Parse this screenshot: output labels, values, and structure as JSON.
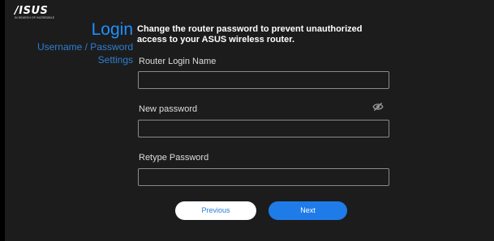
{
  "brand": {
    "logo_text": "/ISUS",
    "tagline": "IN SEARCH OF INCREDIBLE"
  },
  "sidebar": {
    "title": "Login",
    "subtitle_line1": "Username / Password",
    "subtitle_line2": "Settings"
  },
  "main": {
    "heading": "Change the router password to prevent unauthorized access to your ASUS wireless router.",
    "fields": [
      {
        "label": "Router Login Name",
        "value": ""
      },
      {
        "label": "New password",
        "value": "",
        "icon": "eye-slash-icon"
      },
      {
        "label": "Retype Password",
        "value": ""
      }
    ]
  },
  "buttons": {
    "previous": "Previous",
    "next": "Next"
  },
  "colors": {
    "accent": "#1e90ff",
    "background": "#1c1c1c",
    "button_next": "#1f7be8",
    "button_prev": "#ffffff"
  }
}
